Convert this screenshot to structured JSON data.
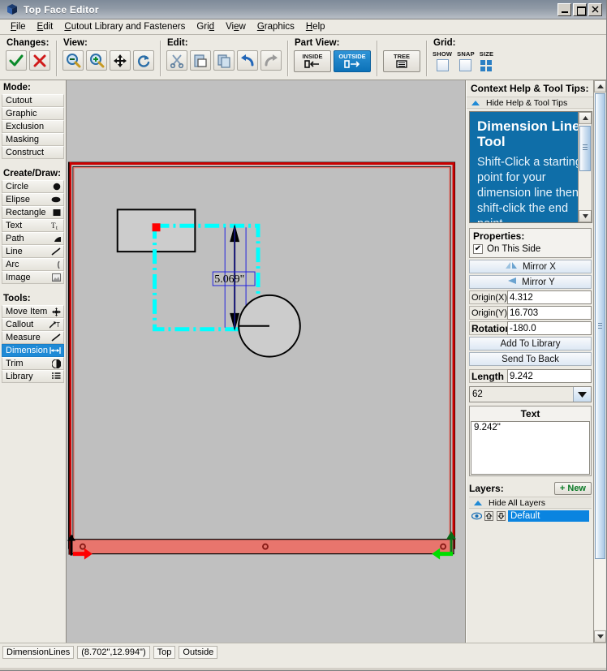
{
  "window": {
    "title": "Top Face Editor",
    "minimize_label": "_",
    "maximize_label": "□",
    "close_label": "✕"
  },
  "menubar": {
    "items": [
      {
        "label": "File"
      },
      {
        "label": "Edit"
      },
      {
        "label": "Cutout Library and Fasteners"
      },
      {
        "label": "Grid"
      },
      {
        "label": "View"
      },
      {
        "label": "Graphics"
      },
      {
        "label": "Help"
      }
    ]
  },
  "toolbar": {
    "changes": {
      "label": "Changes:",
      "accept": "accept-check-icon",
      "cancel": "cancel-x-icon"
    },
    "view": {
      "label": "View:",
      "buttons": [
        "zoom-out-icon",
        "zoom-in-icon",
        "pan-move-icon",
        "refresh-icon"
      ]
    },
    "edit": {
      "label": "Edit:",
      "buttons": [
        "cut-scissors-icon",
        "paste-icon",
        "copy-icon",
        "undo-icon",
        "redo-icon"
      ]
    },
    "part_view": {
      "label": "Part View:",
      "inside_label": "INSIDE",
      "outside_label": "OUTSIDE",
      "tree_label": "TREE",
      "selected": "OUTSIDE"
    },
    "grid": {
      "label": "Grid:",
      "show_label": "SHOW",
      "snap_label": "SNAP",
      "size_label": "SIZE",
      "show_checked": false,
      "snap_checked": false
    }
  },
  "left_panel": {
    "mode": {
      "label": "Mode:",
      "items": [
        {
          "label": "Cutout",
          "selected": false
        },
        {
          "label": "Graphic",
          "selected": false
        },
        {
          "label": "Exclusion",
          "selected": false
        },
        {
          "label": "Masking",
          "selected": false
        },
        {
          "label": "Construct",
          "selected": false
        }
      ]
    },
    "create_draw": {
      "label": "Create/Draw:",
      "items": [
        {
          "label": "Circle",
          "icon": "circle-icon",
          "selected": false
        },
        {
          "label": "Elipse",
          "icon": "ellipse-icon",
          "selected": false
        },
        {
          "label": "Rectangle",
          "icon": "rectangle-icon",
          "selected": false
        },
        {
          "label": "Text",
          "icon": "text-icon",
          "selected": false
        },
        {
          "label": "Path",
          "icon": "path-icon",
          "selected": false
        },
        {
          "label": "Line",
          "icon": "line-icon",
          "selected": false
        },
        {
          "label": "Arc",
          "icon": "arc-icon",
          "selected": false
        },
        {
          "label": "Image",
          "icon": "image-icon",
          "selected": false
        }
      ]
    },
    "tools": {
      "label": "Tools:",
      "items": [
        {
          "label": "Move Item",
          "icon": "move-item-icon",
          "selected": false
        },
        {
          "label": "Callout",
          "icon": "callout-icon",
          "selected": false
        },
        {
          "label": "Measure",
          "icon": "measure-icon",
          "selected": false
        },
        {
          "label": "Dimension",
          "icon": "dimension-icon",
          "selected": true
        },
        {
          "label": "Trim",
          "icon": "trim-icon",
          "selected": false
        },
        {
          "label": "Library",
          "icon": "library-icon",
          "selected": false
        }
      ]
    }
  },
  "right_panel": {
    "help": {
      "title": "Context Help & Tool Tips:",
      "toggle_label": "Hide Help & Tool Tips",
      "tip_title": "Dimension Line Tool",
      "tip_body": "Shift-Click a starting point for your dimension line then shift-click the end point..."
    },
    "properties": {
      "label": "Properties:",
      "on_this_side_label": "On This Side",
      "on_this_side_checked": true,
      "mirror_x_label": "Mirror X",
      "mirror_y_label": "Mirror Y",
      "origin_x_label": "Origin(X)",
      "origin_x_value": "4.312",
      "origin_y_label": "Origin(Y)",
      "origin_y_value": "16.703",
      "rotation_label": "Rotation",
      "rotation_value": "-180.0",
      "add_to_library_label": "Add To Library",
      "send_to_back_label": "Send To Back",
      "length_label": "Length",
      "length_value": "9.242",
      "font_size_value": "62",
      "text_header": "Text",
      "text_value": "9.242\""
    },
    "layers": {
      "label": "Layers:",
      "new_label": "+ New",
      "hide_all_label": "Hide All Layers",
      "items": [
        {
          "name": "Default",
          "selected": true,
          "visible_icon": "eye-icon",
          "up_icon": "arrow-up-icon",
          "down_icon": "arrow-down-icon"
        }
      ]
    }
  },
  "canvas": {
    "dimension_text": "5.069\"",
    "colors": {
      "background": "#c0c0c0",
      "part_fill": "#bfbfbf",
      "border_red": "#cc0000",
      "highlight_red": "#e87b73",
      "selection_cyan": "#00ffff",
      "handle_red": "#ff0000",
      "dimension_blue": "#0000cc",
      "marker_green": "#00dd00"
    }
  },
  "statusbar": {
    "tool": "DimensionLines",
    "coordinates": "(8.702\",12.994\")",
    "face": "Top",
    "side": "Outside"
  }
}
